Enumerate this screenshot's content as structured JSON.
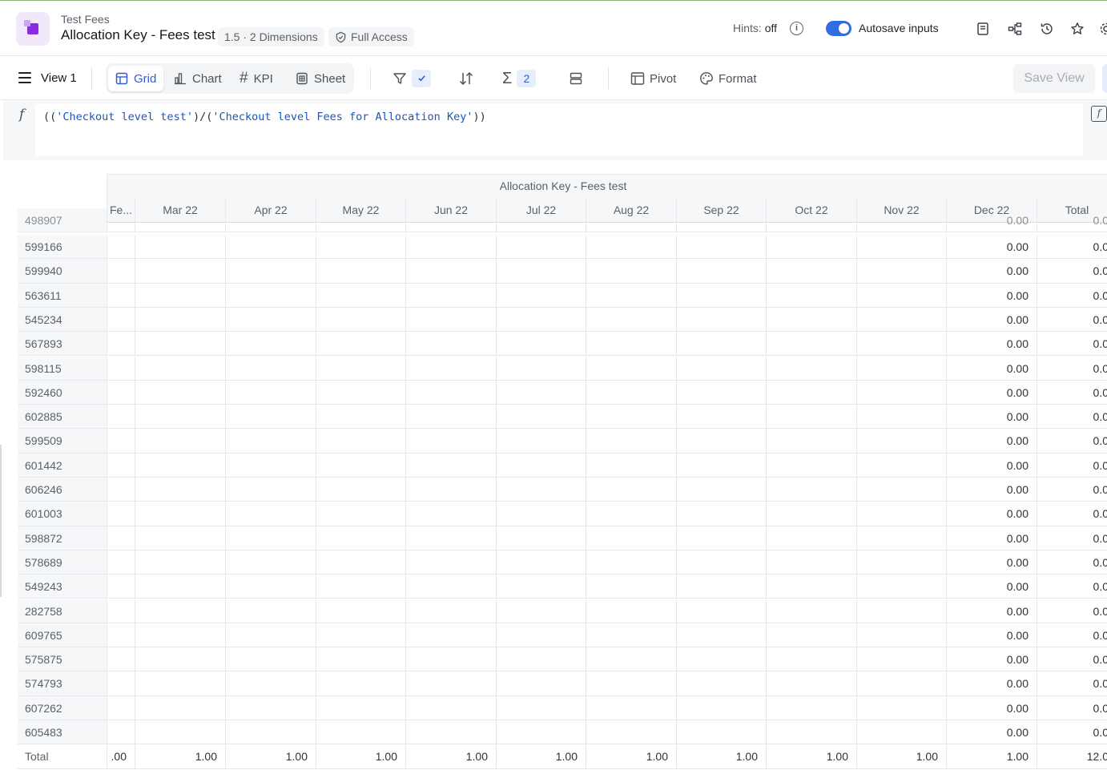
{
  "header": {
    "breadcrumb": "Test Fees",
    "title": "Allocation Key - Fees test",
    "version": "1.5 · 2 Dimensions",
    "access": "Full Access",
    "hints_label": "Hints:",
    "hints_value": "off",
    "autosave_label": "Autosave inputs",
    "autosave_on": true,
    "icons": [
      "document-icon",
      "hierarchy-icon",
      "history-icon",
      "star-icon",
      "settings-icon"
    ]
  },
  "toolbar": {
    "view_name": "View 1",
    "modes": [
      {
        "label": "Grid",
        "icon": "grid-icon",
        "active": true
      },
      {
        "label": "Chart",
        "icon": "bar-chart-icon",
        "active": false
      },
      {
        "label": "KPI",
        "icon": "hash-icon",
        "active": false
      },
      {
        "label": "Sheet",
        "icon": "sheet-icon",
        "active": false
      }
    ],
    "sum_count": "2",
    "pivot_label": "Pivot",
    "format_label": "Format",
    "save_view_label": "Save View"
  },
  "formula": {
    "prefix": "((",
    "ref1": "'Checkout level test'",
    "mid": ")/(",
    "ref2": "'Checkout level Fees for Allocation Key'",
    "suffix": "))"
  },
  "grid": {
    "group_header": "Allocation Key - Fees test",
    "columns": [
      "Fe...",
      "Mar 22",
      "Apr 22",
      "May 22",
      "Jun 22",
      "Jul 22",
      "Aug 22",
      "Sep 22",
      "Oct 22",
      "Nov 22",
      "Dec 22",
      "Total"
    ],
    "partial_row": {
      "label": "498907",
      "dec": "0.00",
      "total": "0.0"
    },
    "rows": [
      {
        "label": "599166",
        "dec": "0.00",
        "total": "0.0"
      },
      {
        "label": "599940",
        "dec": "0.00",
        "total": "0.0"
      },
      {
        "label": "563611",
        "dec": "0.00",
        "total": "0.0"
      },
      {
        "label": "545234",
        "dec": "0.00",
        "total": "0.0"
      },
      {
        "label": "567893",
        "dec": "0.00",
        "total": "0.0"
      },
      {
        "label": "598115",
        "dec": "0.00",
        "total": "0.0"
      },
      {
        "label": "592460",
        "dec": "0.00",
        "total": "0.0"
      },
      {
        "label": "602885",
        "dec": "0.00",
        "total": "0.0"
      },
      {
        "label": "599509",
        "dec": "0.00",
        "total": "0.0"
      },
      {
        "label": "601442",
        "dec": "0.00",
        "total": "0.0"
      },
      {
        "label": "606246",
        "dec": "0.00",
        "total": "0.0"
      },
      {
        "label": "601003",
        "dec": "0.00",
        "total": "0.0"
      },
      {
        "label": "598872",
        "dec": "0.00",
        "total": "0.0"
      },
      {
        "label": "578689",
        "dec": "0.00",
        "total": "0.0"
      },
      {
        "label": "549243",
        "dec": "0.00",
        "total": "0.0"
      },
      {
        "label": "282758",
        "dec": "0.00",
        "total": "0.0"
      },
      {
        "label": "609765",
        "dec": "0.00",
        "total": "0.0"
      },
      {
        "label": "575875",
        "dec": "0.00",
        "total": "0.0"
      },
      {
        "label": "574793",
        "dec": "0.00",
        "total": "0.0"
      },
      {
        "label": "607262",
        "dec": "0.00",
        "total": "0.0"
      },
      {
        "label": "605483",
        "dec": "0.00",
        "total": "0.0"
      }
    ],
    "total_row": {
      "label": "Total",
      "values": [
        ".00",
        "1.00",
        "1.00",
        "1.00",
        "1.00",
        "1.00",
        "1.00",
        "1.00",
        "1.00",
        "1.00",
        "1.00",
        "12.0"
      ]
    }
  },
  "colors": {
    "accent": "#2f5fd0",
    "toggle": "#2f6de1",
    "app_icon": "#8a2be2"
  }
}
